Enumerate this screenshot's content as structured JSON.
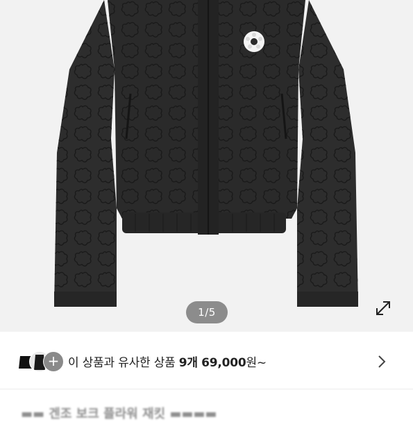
{
  "gallery": {
    "image_icon": "black-quilted-flower-jacket",
    "counter": "1/5",
    "expand_icon": "expand-arrows-icon"
  },
  "similar": {
    "text_prefix": "이 상품과 유사한 상품 ",
    "count": "9개",
    "price": "69,000",
    "suffix": "원~",
    "thumb_plus": "+",
    "chevron_icon": "chevron-right-icon"
  },
  "title_peek": {
    "text": "▬▬ 겐조 보크 플라워 재킷 ▬▬▬▬"
  },
  "colors": {
    "background": "#f2f2f2",
    "counter_bg": "#8c8c8c",
    "jacket": "#2b2b2b",
    "text": "#222222"
  }
}
